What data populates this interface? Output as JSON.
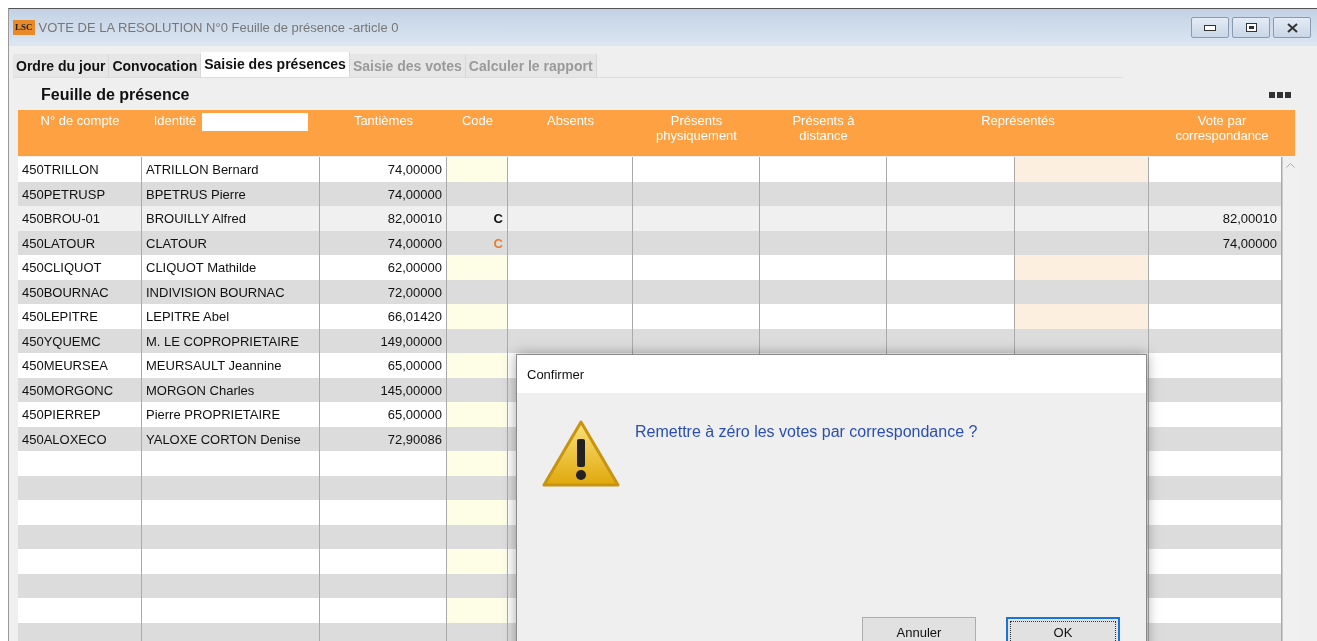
{
  "window": {
    "logo": "LSC",
    "title": "VOTE DE LA RESOLUTION N°0 Feuille de présence -article 0"
  },
  "tabs": [
    {
      "label": "Ordre du jour",
      "selected": false,
      "disabled": false
    },
    {
      "label": "Convocation",
      "selected": false,
      "disabled": false
    },
    {
      "label": "Saisie des présences",
      "selected": true,
      "disabled": false
    },
    {
      "label": "Saisie des votes",
      "selected": false,
      "disabled": true
    },
    {
      "label": "Calculer le rapport",
      "selected": false,
      "disabled": true
    }
  ],
  "section_title": "Feuille de présence",
  "table": {
    "columns": [
      {
        "label": "N° de compte",
        "filter": false
      },
      {
        "label": "Identité",
        "filter": true
      },
      {
        "label": "Tantièmes",
        "filter": false
      },
      {
        "label": "Code",
        "filter": false
      },
      {
        "label": "Absents",
        "filter": false
      },
      {
        "label": "Présents physiquement",
        "filter": false
      },
      {
        "label": "Présents à distance",
        "filter": false
      },
      {
        "label": "Représentés",
        "filter": false
      },
      {
        "label": "Vote par correspondance",
        "filter": false
      }
    ],
    "rows": [
      {
        "account": "450TRILLON",
        "identity": "ATRILLON Bernard",
        "tantiemes": "74,00000",
        "selected": false,
        "editable": true
      },
      {
        "account": "450PETRUSP",
        "identity": "BPETRUS Pierre",
        "tantiemes": "74,00000",
        "selected": false,
        "editable": false
      },
      {
        "account": "450BROU-01",
        "identity": "BROUILLY Alfred",
        "tantiemes": "82,00010",
        "code": {
          "text": "C",
          "color": "#111111"
        },
        "vote": "82,00010",
        "selected": true,
        "editable": false
      },
      {
        "account": "450LATOUR",
        "identity": "CLATOUR",
        "tantiemes": "74,00000",
        "code": {
          "text": "C",
          "color": "#f07a28"
        },
        "vote": "74,00000",
        "selected": false,
        "editable": false
      },
      {
        "account": "450CLIQUOT",
        "identity": "CLIQUOT Mathilde",
        "tantiemes": "62,00000",
        "selected": false,
        "editable": true
      },
      {
        "account": "450BOURNAC",
        "identity": "INDIVISION BOURNAC",
        "tantiemes": "72,00000",
        "selected": false,
        "editable": false
      },
      {
        "account": "450LEPITRE",
        "identity": "LEPITRE Abel",
        "tantiemes": "66,01420",
        "selected": false,
        "editable": true
      },
      {
        "account": "450YQUEMC",
        "identity": "M. LE COPROPRIETAIRE",
        "tantiemes": "149,00000",
        "selected": false,
        "editable": false
      },
      {
        "account": "450MEURSEA",
        "identity": "MEURSAULT Jeannine",
        "tantiemes": "65,00000",
        "selected": false,
        "editable": true
      },
      {
        "account": "450MORGONC",
        "identity": "MORGON Charles",
        "tantiemes": "145,00000",
        "selected": false,
        "editable": false
      },
      {
        "account": "450PIERREP",
        "identity": "Pierre PROPRIETAIRE",
        "tantiemes": "65,00000",
        "selected": false,
        "editable": true
      },
      {
        "account": "450ALOXECO",
        "identity": "YALOXE CORTON Denise",
        "tantiemes": "72,90086",
        "selected": false,
        "editable": false
      },
      {
        "selected": false,
        "editable": true
      },
      {
        "selected": false,
        "editable": false
      },
      {
        "selected": false,
        "editable": true
      },
      {
        "selected": false,
        "editable": false
      },
      {
        "selected": false,
        "editable": true
      },
      {
        "selected": false,
        "editable": false
      },
      {
        "selected": false,
        "editable": true
      },
      {
        "selected": false,
        "editable": false
      }
    ]
  },
  "dialog": {
    "title": "Confirmer",
    "message": "Remettre à zéro les votes par correspondance ?",
    "buttons": [
      {
        "label": "Annuler",
        "focused": false
      },
      {
        "label": "OK",
        "focused": true
      }
    ]
  }
}
